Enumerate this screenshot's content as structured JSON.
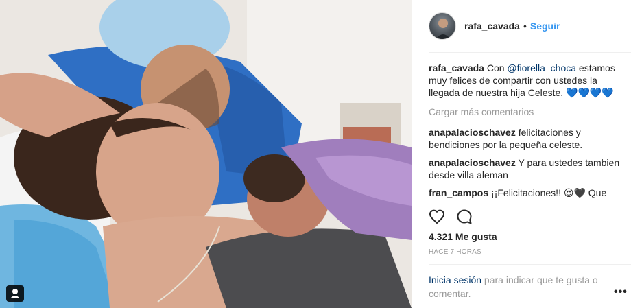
{
  "header": {
    "username": "rafa_cavada",
    "separator": "•",
    "follow_label": "Seguir"
  },
  "caption": {
    "username": "rafa_cavada",
    "text_before": "Con ",
    "mention": "@fiorella_choca",
    "text_after": " estamos muy felices de compartir con ustedes la llegada de nuestra hija Celeste. 💙💙💙💙"
  },
  "load_more_label": "Cargar más comentarios",
  "comments": [
    {
      "username": "anapalacioschavez",
      "text": "felicitaciones y bendiciones por la pequeña celeste."
    },
    {
      "username": "anapalacioschavez",
      "text": "Y para ustedes tambien desde villa aleman"
    },
    {
      "username": "fran_campos",
      "text": "¡¡Felicitaciones!! 😍🖤 Que hermosura"
    }
  ],
  "likes_label": "4.321 Me gusta",
  "time_label": "Hace 7 horas",
  "login": {
    "link": "Inicia sesión",
    "text": " para indicar que te gusta o comentar."
  },
  "more_label": "•••",
  "icons": {
    "like": "heart-icon",
    "comment": "comment-icon",
    "tag": "user-tag-icon",
    "more": "more-options-icon"
  }
}
